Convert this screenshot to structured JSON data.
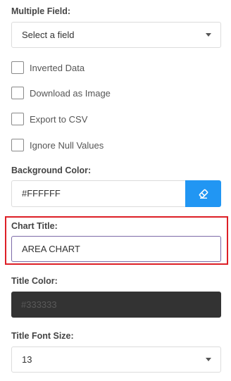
{
  "multiple_field": {
    "label": "Multiple Field:",
    "selected": "Select a field"
  },
  "options": [
    {
      "label": "Inverted Data",
      "checked": false
    },
    {
      "label": "Download as Image",
      "checked": false
    },
    {
      "label": "Export to CSV",
      "checked": false
    },
    {
      "label": "Ignore Null Values",
      "checked": false
    }
  ],
  "background_color": {
    "label": "Background Color:",
    "value": "#FFFFFF",
    "clear_icon": "eraser-icon",
    "button_color": "#2196F3"
  },
  "chart_title": {
    "label": "Chart Title:",
    "value": "AREA CHART",
    "highlight_color": "#DD1F26"
  },
  "title_color": {
    "label": "Title Color:",
    "value": "#333333"
  },
  "title_font_size": {
    "label": "Title Font Size:",
    "selected": "13"
  }
}
